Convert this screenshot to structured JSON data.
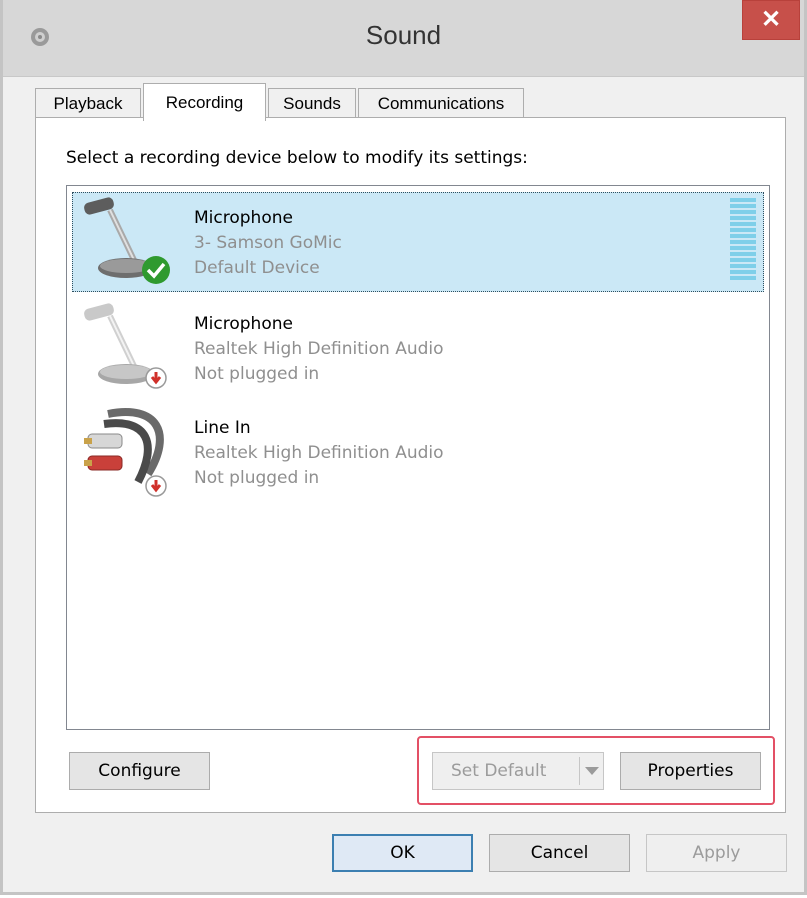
{
  "window": {
    "title": "Sound",
    "close_label": "✕"
  },
  "tabs": [
    {
      "label": "Playback"
    },
    {
      "label": "Recording",
      "active": true
    },
    {
      "label": "Sounds"
    },
    {
      "label": "Communications"
    }
  ],
  "instruction": "Select a recording device below to modify its settings:",
  "devices": [
    {
      "name": "Microphone",
      "driver": "3- Samson GoMic",
      "status": "Default Device",
      "icon": "microphone-icon",
      "badge": "default-check-icon",
      "selected": true
    },
    {
      "name": "Microphone",
      "driver": "Realtek High Definition Audio",
      "status": "Not plugged in",
      "icon": "microphone-icon",
      "badge": "unplugged-arrow-icon",
      "selected": false
    },
    {
      "name": "Line In",
      "driver": "Realtek High Definition Audio",
      "status": "Not plugged in",
      "icon": "line-in-cable-icon",
      "badge": "unplugged-arrow-icon",
      "selected": false
    }
  ],
  "buttons": {
    "configure": "Configure",
    "set_default": "Set Default",
    "properties": "Properties",
    "ok": "OK",
    "cancel": "Cancel",
    "apply": "Apply"
  },
  "colors": {
    "close": "#c7504a",
    "selection": "#cbe8f6",
    "highlight_box": "#e35065",
    "level_meter": "#7fcfe9"
  }
}
